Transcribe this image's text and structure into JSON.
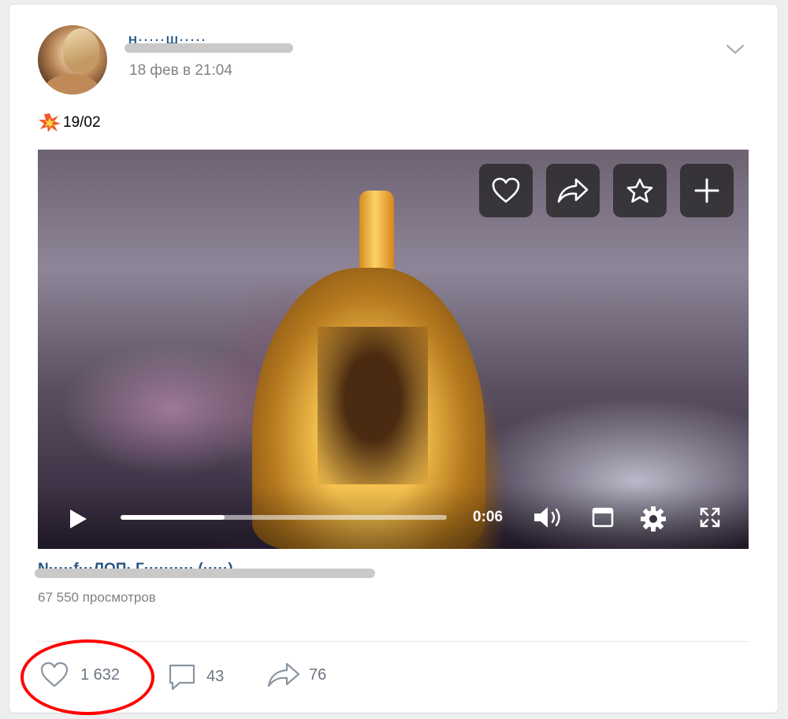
{
  "post": {
    "author_name": "Н·····Ш·····",
    "date": "18 фев в 21:04",
    "text": "19/02",
    "text_icon": "collision-icon"
  },
  "video": {
    "time": "0:06",
    "progress": 0.32,
    "overlay_buttons": [
      "heart-icon",
      "share-icon",
      "star-icon",
      "plus-icon"
    ],
    "controls": [
      "play-icon",
      "volume-icon",
      "miniplayer-icon",
      "settings-icon",
      "fullscreen-icon"
    ],
    "title": "N·····f···ЛОП· Г·········· (·····)",
    "views": "67 550 просмотров"
  },
  "actions": {
    "likes": "1 632",
    "comments": "43",
    "shares": "76"
  },
  "colors": {
    "link": "#2a5885",
    "muted": "#828282",
    "highlight": "#ff0000"
  }
}
